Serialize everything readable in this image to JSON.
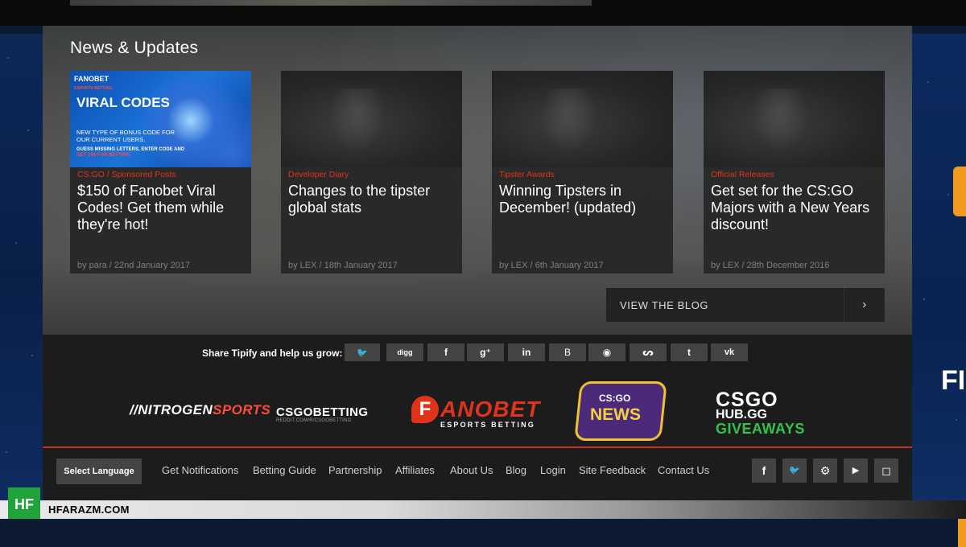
{
  "news": {
    "heading": "News & Updates",
    "cards": [
      {
        "category": "CS:GO / Sponsored Posts",
        "title": "$150 of Fanobet Viral Codes! Get them while they're hot!",
        "meta": "by para / 22nd January 2017",
        "thumb": {
          "brand": "FANOBET",
          "brand_tag": "ESPORTS BETTING",
          "headline": "VIRAL CODES",
          "sub": "NEW TYPE OF BONUS CODE FOR OUR CURRENT USERS.",
          "sub2": "GUESS MISSING LETTERS, ENTER CODE AND",
          "sub2_hi": "GET 10$ FOR BETTING"
        }
      },
      {
        "category": "Developer Diary",
        "title": "Changes to the tipster global stats",
        "meta": "by LEX / 18th January 2017"
      },
      {
        "category": "Tipster Awards",
        "title": "Winning Tipsters in December! (updated)",
        "meta": "by LEX / 6th January 2017"
      },
      {
        "category": "Official Releases",
        "title": "Get set for the CS:GO Majors with a New Years discount!",
        "meta": "by LEX / 28th December 2016"
      }
    ],
    "view_blog": "VIEW THE BLOG",
    "view_blog_arrow": "›"
  },
  "share": {
    "label": "Share Tipify and help us grow:",
    "buttons": [
      {
        "icon": "twitter-icon",
        "glyph": "🐦"
      },
      {
        "icon": "digg-icon",
        "glyph": "digg"
      },
      {
        "icon": "facebook-icon",
        "glyph": "f"
      },
      {
        "icon": "google-plus-icon",
        "glyph": "g⁺"
      },
      {
        "icon": "linkedin-icon",
        "glyph": "in"
      },
      {
        "icon": "blogger-icon",
        "glyph": "B"
      },
      {
        "icon": "reddit-icon",
        "glyph": "◉"
      },
      {
        "icon": "stumbleupon-icon",
        "glyph": "ᔕ"
      },
      {
        "icon": "tumblr-icon",
        "glyph": "t"
      },
      {
        "icon": "vk-icon",
        "glyph": "vk"
      }
    ]
  },
  "partners": {
    "nitrogen": {
      "a": "//NITROGEN",
      "b": "SPORTS"
    },
    "csgobetting": {
      "main": "CSGOBETTING",
      "small": "REDDIT.COM/R/CSGOBETTING"
    },
    "fanobet": {
      "mark": "F",
      "word": "ANOBET",
      "tag": "ESPORTS BETTING"
    },
    "csgonews": {
      "t1": "CS:GO",
      "t2": "NEWS"
    },
    "csgohub": {
      "l1": "CSGO",
      "l2": "HUB.GG",
      "l3": "GIVEAWAYS"
    }
  },
  "footer": {
    "language": "Select Language",
    "nav": [
      "Get Notifications",
      "Betting Guide",
      "Partnership",
      "Affiliates",
      "About Us",
      "Blog",
      "Login",
      "Site Feedback",
      "Contact Us"
    ],
    "social": [
      {
        "icon": "facebook-icon",
        "glyph": "f"
      },
      {
        "icon": "twitter-icon",
        "glyph": "🐦"
      },
      {
        "icon": "steam-icon",
        "glyph": "⚙"
      },
      {
        "icon": "youtube-icon",
        "glyph": "▶"
      },
      {
        "icon": "twitch-icon",
        "glyph": "◻"
      }
    ]
  },
  "side_text": "FI",
  "watermark": {
    "logo": "HF",
    "text": "HFARAZM.COM"
  }
}
